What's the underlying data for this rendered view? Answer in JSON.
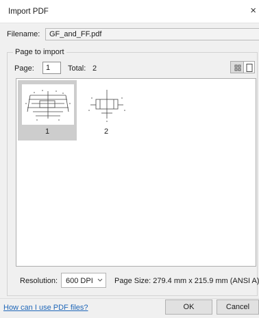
{
  "window": {
    "title": "Import PDF",
    "close_glyph": "×"
  },
  "filename": {
    "label": "Filename:",
    "value": "GF_and_FF.pdf"
  },
  "group": {
    "caption": "Page to import"
  },
  "page": {
    "label": "Page:",
    "value": "1",
    "total_label": "Total:",
    "total_value": "2"
  },
  "view_toggle": {
    "selected": "grid-view",
    "options": [
      "grid-view-icon",
      "single-page-icon"
    ]
  },
  "thumbnails": [
    {
      "number": "1",
      "selected": true
    },
    {
      "number": "2",
      "selected": false
    }
  ],
  "resolution": {
    "label": "Resolution:",
    "value": "600 DPI",
    "chevron_glyph": "⌄"
  },
  "page_size": "Page Size: 279.4 mm x 215.9 mm (ANSI A)",
  "footer": {
    "help_link": "How can I use PDF files?",
    "ok_label": "OK",
    "cancel_label": "Cancel"
  },
  "colors": {
    "background": "#f0f0f0",
    "link": "#1e66b8",
    "selection": "#cdcdcd"
  }
}
